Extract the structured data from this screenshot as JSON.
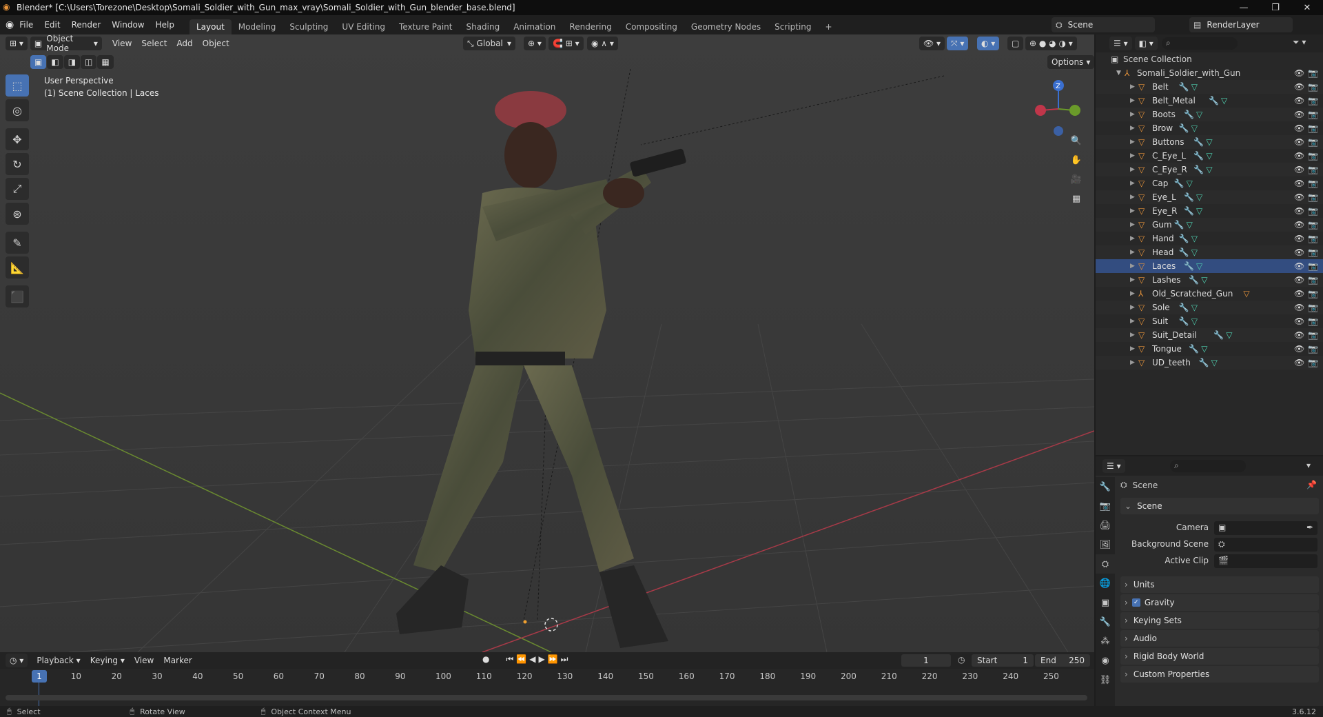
{
  "window": {
    "title": "Blender* [C:\\Users\\Torezone\\Desktop\\Somali_Soldier_with_Gun_max_vray\\Somali_Soldier_with_Gun_blender_base.blend]"
  },
  "menu": [
    "File",
    "Edit",
    "Render",
    "Window",
    "Help"
  ],
  "workspaces": [
    "Layout",
    "Modeling",
    "Sculpting",
    "UV Editing",
    "Texture Paint",
    "Shading",
    "Animation",
    "Rendering",
    "Compositing",
    "Geometry Nodes",
    "Scripting"
  ],
  "active_workspace": "Layout",
  "scene_name": "Scene",
  "view_layer": "RenderLayer",
  "viewport": {
    "mode": "Object Mode",
    "menus": [
      "View",
      "Select",
      "Add",
      "Object"
    ],
    "orientation": "Global",
    "options_label": "Options",
    "perspective_label": "User Perspective",
    "collection_label": "(1) Scene Collection | Laces",
    "gizmo_z": "Z"
  },
  "outliner": {
    "root": "Scene Collection",
    "collection": "Somali_Soldier_with_Gun",
    "items": [
      "Belt",
      "Belt_Metal",
      "Boots",
      "Brow",
      "Buttons",
      "C_Eye_L",
      "C_Eye_R",
      "Cap",
      "Eye_L",
      "Eye_R",
      "Gum",
      "Hand",
      "Head",
      "Laces",
      "Lashes",
      "Old_Scratched_Gun",
      "Sole",
      "Suit",
      "Suit_Detail",
      "Tongue",
      "UD_teeth"
    ],
    "active_item": "Laces"
  },
  "properties": {
    "header": "Scene",
    "section": "Scene",
    "fields": [
      {
        "label": "Camera",
        "value": ""
      },
      {
        "label": "Background Scene",
        "value": ""
      },
      {
        "label": "Active Clip",
        "value": ""
      }
    ],
    "panels": [
      "Units",
      "Gravity",
      "Keying Sets",
      "Audio",
      "Rigid Body World",
      "Custom Properties"
    ],
    "gravity_checked": true
  },
  "timeline": {
    "menus": [
      "Playback",
      "Keying",
      "View",
      "Marker"
    ],
    "current_frame": "1",
    "start_label": "Start",
    "start": "1",
    "end_label": "End",
    "end": "250",
    "ticks": [
      "10",
      "20",
      "30",
      "40",
      "50",
      "60",
      "70",
      "80",
      "90",
      "100",
      "110",
      "120",
      "130",
      "140",
      "150",
      "160",
      "170",
      "180",
      "190",
      "200",
      "210",
      "220",
      "230",
      "240",
      "250"
    ],
    "playhead_label": "1"
  },
  "statusbar": {
    "items": [
      "Select",
      "Rotate View",
      "Object Context Menu"
    ],
    "version": "3.6.12"
  },
  "colors": {
    "accent": "#4772b3",
    "object_icon": "#e8943a",
    "modifier_icon": "#5f9be8",
    "mesh_icon": "#4fd0b0"
  }
}
